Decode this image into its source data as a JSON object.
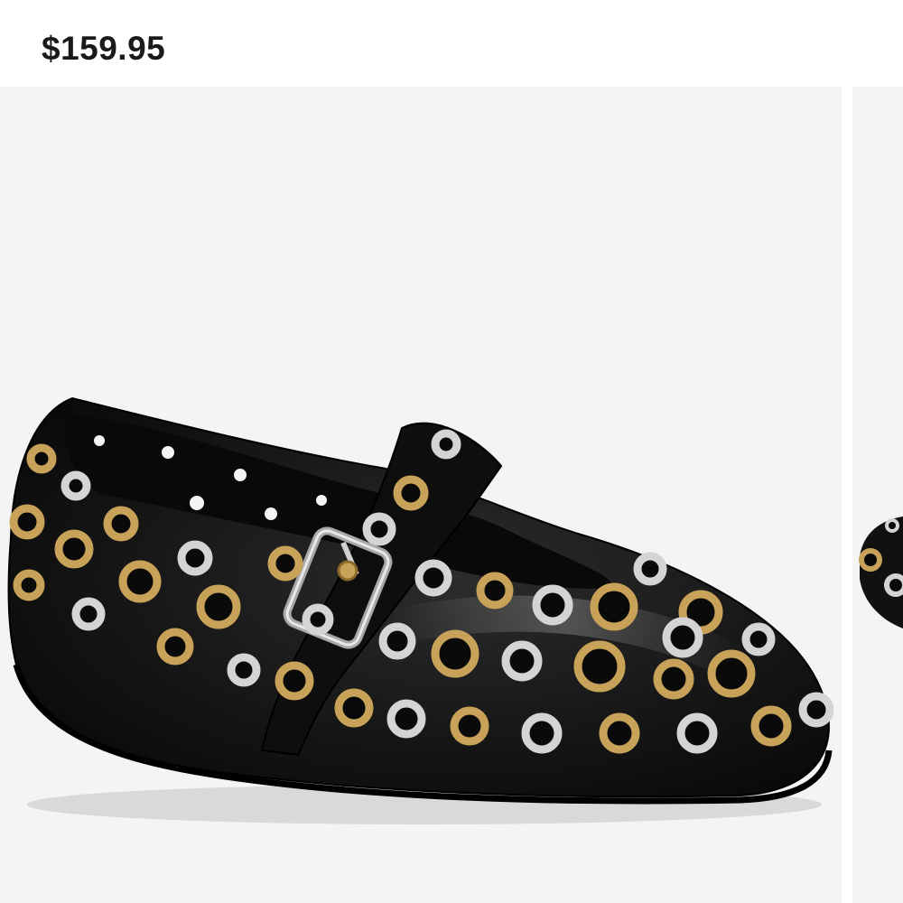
{
  "product": {
    "price": "$159.95"
  },
  "gallery": {
    "main_image_icon": "product-photo-black-grommet-mary-jane-flat",
    "next_image_icon": "product-photo-next-thumbnail",
    "background": "#f4f4f5"
  },
  "colors": {
    "price_text": "#1a1a1a",
    "shoe_leather": "#111111",
    "grommet_gold": "#c9a25a",
    "grommet_silver": "#cfcfcf"
  }
}
